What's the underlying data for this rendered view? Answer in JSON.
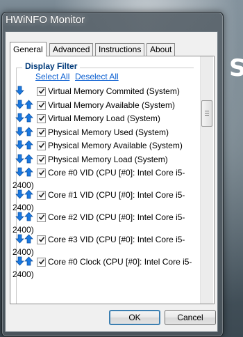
{
  "window": {
    "title": "HWiNFO Monitor"
  },
  "desktop": {
    "partial_text": "S"
  },
  "tabs": [
    "General",
    "Advanced",
    "Instructions",
    "About"
  ],
  "display_filter": {
    "title": "Display Filter",
    "select_all": "Select All",
    "deselect_all": "Deselect All",
    "items": [
      {
        "label": "Virtual Memory Commited (System)",
        "line2": "",
        "checked": true,
        "up_arrow": false
      },
      {
        "label": "Virtual Memory Available (System)",
        "line2": "",
        "checked": true,
        "up_arrow": true
      },
      {
        "label": "Virtual Memory Load (System)",
        "line2": "",
        "checked": true,
        "up_arrow": true
      },
      {
        "label": "Physical Memory Used (System)",
        "line2": "",
        "checked": true,
        "up_arrow": true
      },
      {
        "label": "Physical Memory Available (System)",
        "line2": "",
        "checked": true,
        "up_arrow": true
      },
      {
        "label": "Physical Memory Load (System)",
        "line2": "",
        "checked": true,
        "up_arrow": true
      },
      {
        "label": "Core #0 VID (CPU [#0]: Intel Core i5-",
        "line2": "2400)",
        "checked": true,
        "up_arrow": true
      },
      {
        "label": "Core #1 VID (CPU [#0]: Intel Core i5-",
        "line2": "2400)",
        "checked": true,
        "up_arrow": true
      },
      {
        "label": "Core #2 VID (CPU [#0]: Intel Core i5-",
        "line2": "2400)",
        "checked": true,
        "up_arrow": true
      },
      {
        "label": "Core #3 VID (CPU [#0]: Intel Core i5-",
        "line2": "2400)",
        "checked": true,
        "up_arrow": true
      },
      {
        "label": "Core #0 Clock (CPU [#0]: Intel Core i5-",
        "line2": "2400)",
        "checked": true,
        "up_arrow": true
      }
    ]
  },
  "buttons": {
    "ok": "OK",
    "cancel": "Cancel"
  },
  "colors": {
    "link": "#0b5fd1",
    "group_title": "#003a7a",
    "arrow_blue": "#1a78e0"
  }
}
